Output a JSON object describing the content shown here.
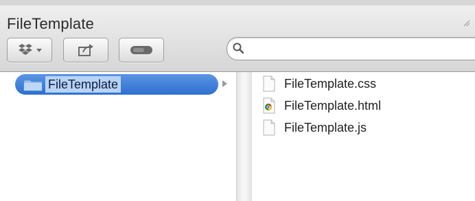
{
  "window": {
    "title": "FileTemplate"
  },
  "toolbar": {
    "buttons": [
      {
        "name": "actions",
        "icon": "dropbox-icon"
      },
      {
        "name": "share",
        "icon": "share-icon"
      },
      {
        "name": "toggle",
        "icon": "toggle-pill-icon"
      }
    ],
    "search": {
      "value": "",
      "placeholder": ""
    }
  },
  "sidebar": {
    "items": [
      {
        "label": "FileTemplate",
        "icon": "folder-icon",
        "selected": true
      }
    ]
  },
  "files": [
    {
      "label": "FileTemplate.css",
      "icon": "document-icon"
    },
    {
      "label": "FileTemplate.html",
      "icon": "chrome-document-icon"
    },
    {
      "label": "FileTemplate.js",
      "icon": "document-icon"
    }
  ],
  "colors": {
    "selection": "#2e6fd2",
    "label_highlight": "#b9d3f7",
    "toolbar_bg": "#e0e0e0"
  }
}
